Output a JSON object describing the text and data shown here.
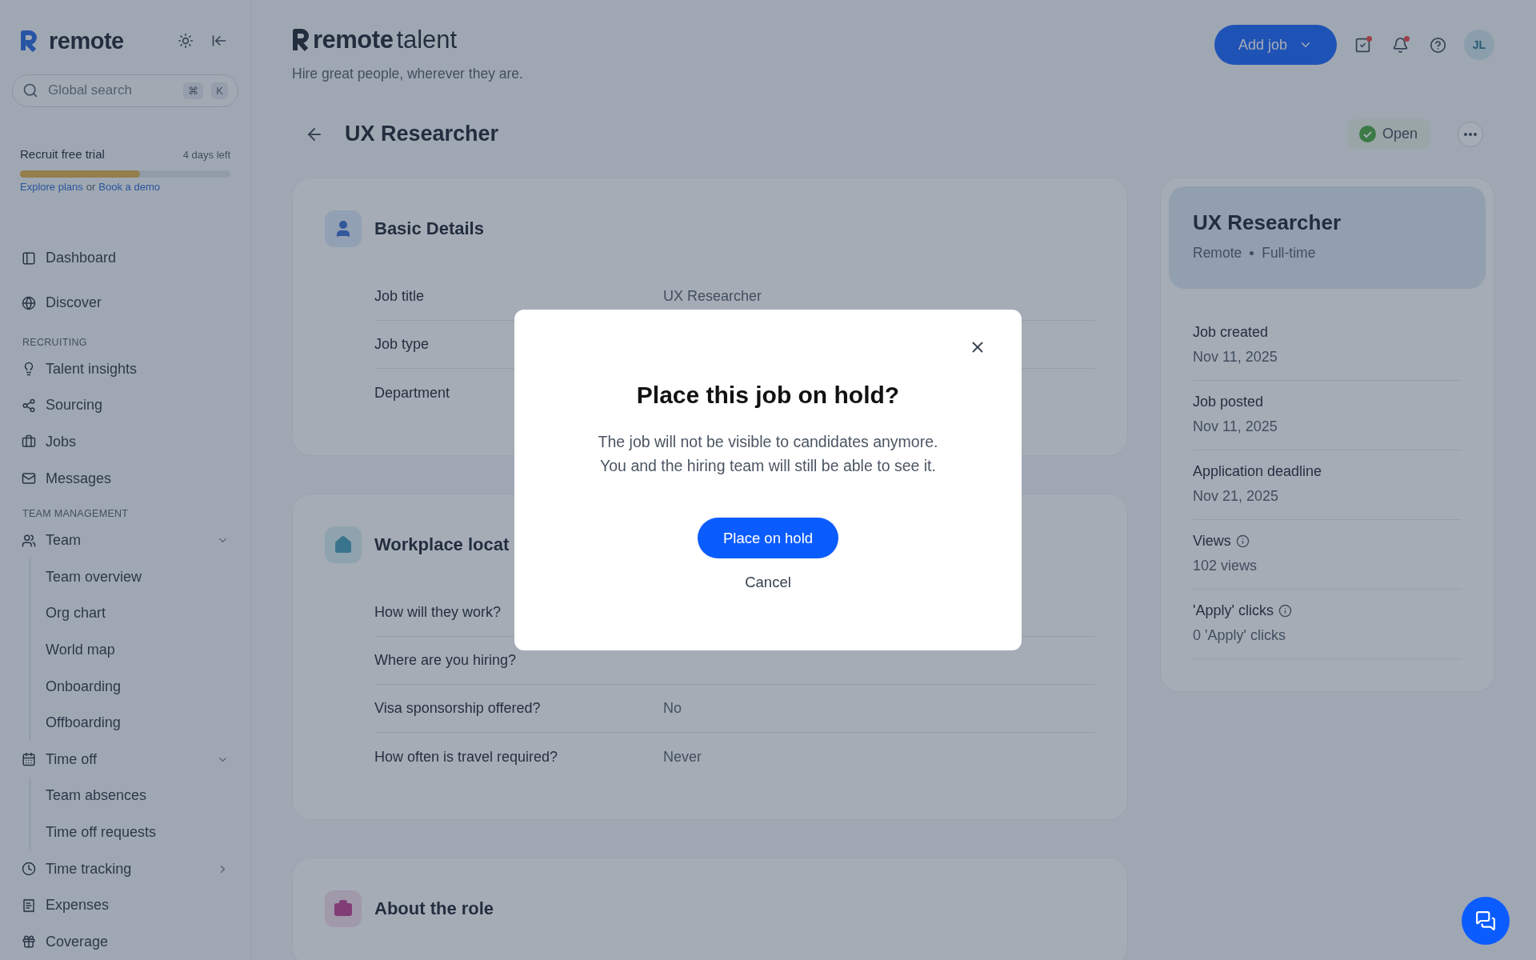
{
  "sidebar": {
    "brand": "remote",
    "search": {
      "placeholder": "Global search",
      "keys": [
        "⌘",
        "K"
      ]
    },
    "trial": {
      "title": "Recruit free trial",
      "remaining": "4 days left",
      "level": 0.57,
      "link_1": "Explore plans",
      "separator": "or",
      "link_2": "Book a demo"
    },
    "nav": [
      {
        "kind": "item",
        "label": "Dashboard"
      },
      {
        "kind": "item",
        "label": "Discover"
      },
      {
        "kind": "heading",
        "label": "RECRUITING"
      },
      {
        "kind": "item",
        "label": "Talent insights"
      },
      {
        "kind": "item",
        "label": "Sourcing"
      },
      {
        "kind": "item",
        "label": "Jobs"
      },
      {
        "kind": "item",
        "label": "Messages"
      },
      {
        "kind": "heading",
        "label": "TEAM MANAGEMENT"
      },
      {
        "kind": "group",
        "label": "Team",
        "expanded": true,
        "children": [
          {
            "label": "Team overview"
          },
          {
            "label": "Org chart"
          },
          {
            "label": "World map"
          },
          {
            "label": "Onboarding"
          },
          {
            "label": "Offboarding"
          }
        ]
      },
      {
        "kind": "group",
        "label": "Time off",
        "expanded": true,
        "children": [
          {
            "label": "Team absences"
          },
          {
            "label": "Time off requests"
          }
        ]
      },
      {
        "kind": "group",
        "label": "Time tracking",
        "expanded": false
      },
      {
        "kind": "item",
        "label": "Expenses"
      },
      {
        "kind": "item",
        "label": "Coverage"
      }
    ]
  },
  "header": {
    "brand": "remote",
    "product": "talent",
    "tagline": "Hire great people, wherever they are.",
    "add_button": "Add job",
    "avatar": "JL"
  },
  "page": {
    "title": "UX Researcher",
    "status": "Open"
  },
  "cards": [
    {
      "title": "Basic Details",
      "rows": [
        {
          "label": "Job title",
          "value": "UX Researcher"
        },
        {
          "label": "Job type"
        },
        {
          "label": "Department"
        }
      ]
    },
    {
      "title": "Workplace locat",
      "rows": [
        {
          "label": "How will they work?"
        },
        {
          "label": "Where are you hiring?"
        },
        {
          "label": "Visa sponsorship offered?",
          "value": "No"
        },
        {
          "label": "How often is travel required?",
          "value": "Never"
        }
      ]
    },
    {
      "title": "About the role"
    }
  ],
  "summary": {
    "title": "UX Researcher",
    "meta": [
      "Remote",
      "Full-time"
    ],
    "stats": [
      {
        "label": "Job created",
        "value": "Nov 11, 2025",
        "info": false
      },
      {
        "label": "Job posted",
        "value": "Nov 11, 2025",
        "info": false
      },
      {
        "label": "Application deadline",
        "value": "Nov 21, 2025",
        "info": false
      },
      {
        "label": "Views",
        "value": "102 views",
        "info": true
      },
      {
        "label": "'Apply' clicks",
        "value": "0 'Apply' clicks",
        "info": true
      }
    ]
  },
  "modal": {
    "title": "Place this job on hold?",
    "body": [
      "The job will not be visible to candidates anymore.",
      "You and the hiring team will still be able to see it."
    ],
    "confirm": "Place on hold",
    "cancel": "Cancel"
  }
}
